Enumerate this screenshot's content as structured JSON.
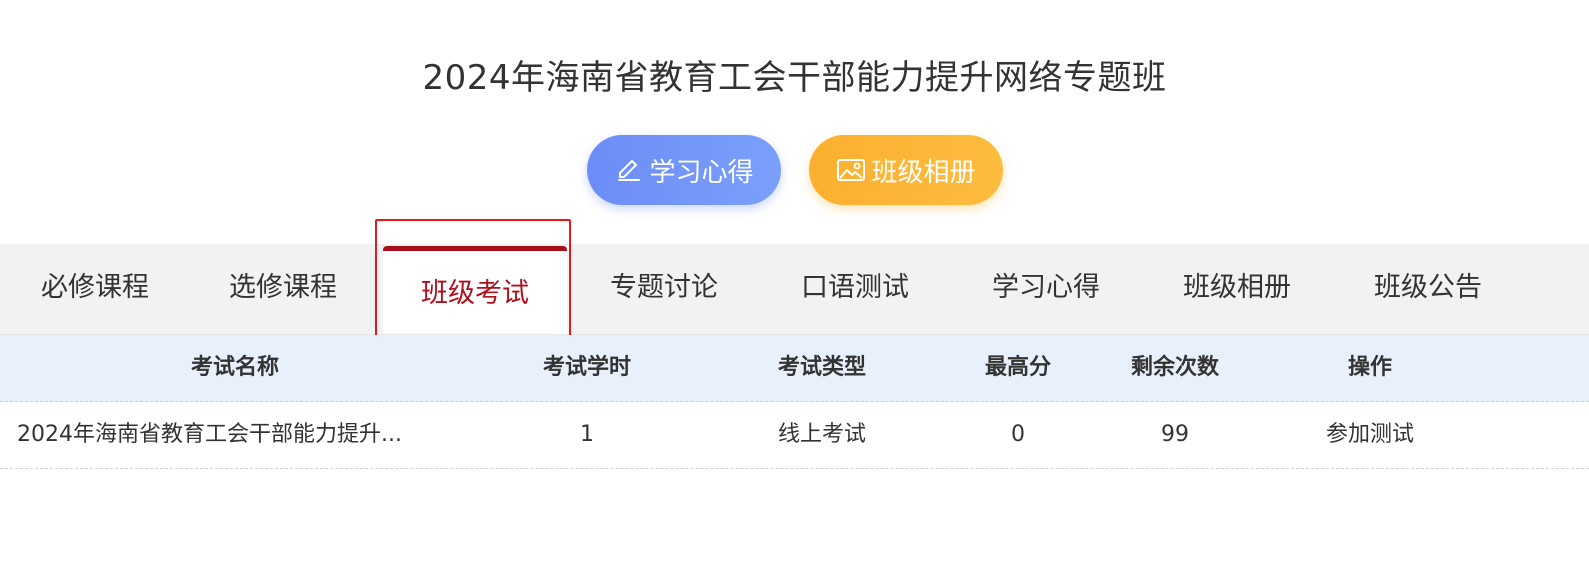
{
  "page": {
    "title": "2024年海南省教育工会干部能力提升网络专题班"
  },
  "quick_buttons": {
    "notes": {
      "label": "学习心得",
      "icon": "pencil-icon",
      "color": "#6c8cf7"
    },
    "album": {
      "label": "班级相册",
      "icon": "image-icon",
      "color": "#fbb02f"
    }
  },
  "tabs": [
    {
      "label": "必修课程"
    },
    {
      "label": "选修课程"
    },
    {
      "label": "班级考试",
      "active": true
    },
    {
      "label": "专题讨论"
    },
    {
      "label": "口语测试"
    },
    {
      "label": "学习心得"
    },
    {
      "label": "班级相册"
    },
    {
      "label": "班级公告"
    }
  ],
  "table": {
    "headers": {
      "name": "考试名称",
      "hours": "考试学时",
      "type": "考试类型",
      "max_score": "最高分",
      "remaining": "剩余次数",
      "action": "操作"
    },
    "rows": [
      {
        "name": "2024年海南省教育工会干部能力提升...",
        "hours": "1",
        "type": "线上考试",
        "max_score": "0",
        "remaining": "99",
        "action": "参加测试"
      }
    ]
  },
  "colors": {
    "active_tab": "#b0101e",
    "highlight_box": "#e51b1b",
    "header_bg": "#e8f0fb"
  }
}
